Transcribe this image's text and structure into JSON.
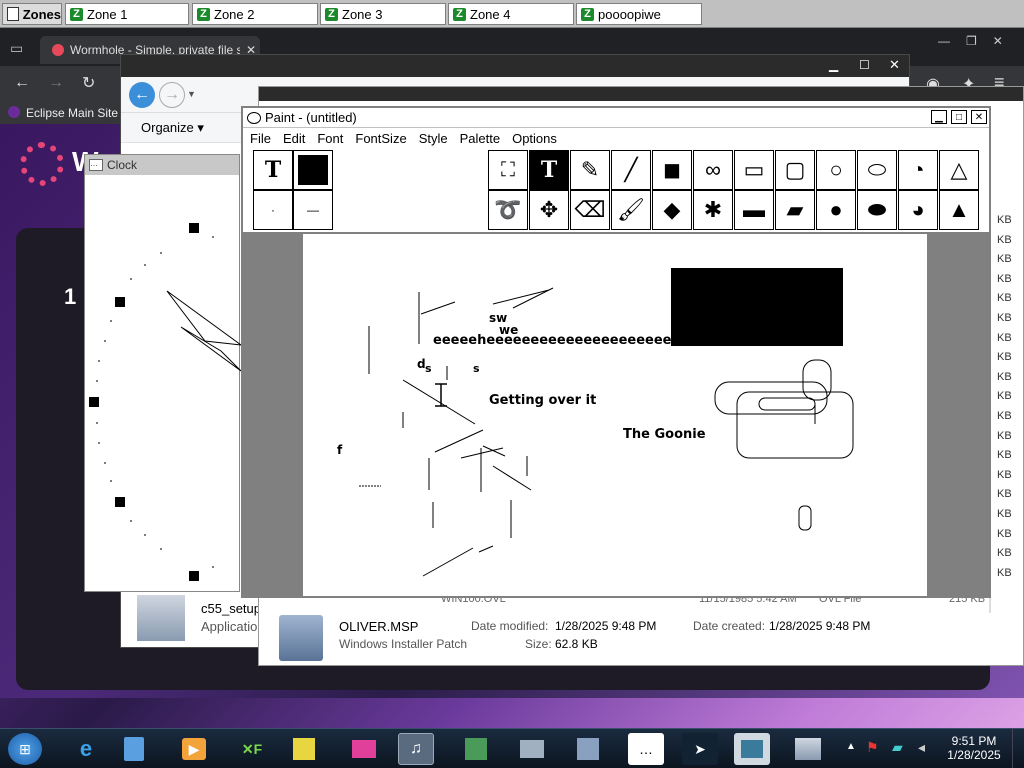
{
  "zones": {
    "title": "Zones",
    "tabs": [
      {
        "label": "Zone 1"
      },
      {
        "label": "Zone 2"
      },
      {
        "label": "Zone 3"
      },
      {
        "label": "Zone 4"
      },
      {
        "label": "poooopiwe"
      }
    ]
  },
  "browser": {
    "tab_title": "Wormhole - Simple, private file s",
    "bookmark": "Eclipse Main Site",
    "page_big_letter": "W",
    "page_number": "1"
  },
  "explorer": {
    "organize_label": "Organize",
    "file_name_1": "c55_setup",
    "file_type_1": "Application",
    "partial_row": "WIN100.OVL",
    "partial_date": "11/15/1985 5:42 AM",
    "partial_type": "OVL File",
    "partial_size": "215 KB",
    "sizes": [
      "KB",
      "KB",
      "KB",
      "KB",
      "KB",
      "KB",
      "KB",
      "KB",
      "KB",
      "KB",
      "KB",
      "KB",
      "KB",
      "KB",
      "KB",
      "KB",
      "KB",
      "KB",
      "KB"
    ],
    "details": {
      "name": "OLIVER.MSP",
      "type": "Windows Installer Patch",
      "date_modified_label": "Date modified:",
      "date_modified": "1/28/2025 9:48 PM",
      "date_created_label": "Date created:",
      "date_created": "1/28/2025 9:48 PM",
      "size_label": "Size:",
      "size": "62.8 KB"
    }
  },
  "clock": {
    "title": "Clock"
  },
  "paint": {
    "title": "Paint - (untitled)",
    "menu": [
      "File",
      "Edit",
      "Font",
      "FontSize",
      "Style",
      "Palette",
      "Options"
    ],
    "canvas_texts": {
      "t1": "Getting over it",
      "t2": "The Goonie",
      "t3": "eeeeeheeeeeeeeeeeeeeeeeeeeeee",
      "t4": "sw",
      "t5": "we",
      "t6": "d",
      "t7": "s",
      "t8": "s",
      "t9": "f"
    }
  },
  "taskbar": {
    "time": "9:51 PM",
    "date": "1/28/2025"
  },
  "colors": {
    "taskbar": "#1a2b3f",
    "zone_icon": "#1b8a2a",
    "browser_dark": "#202124"
  }
}
